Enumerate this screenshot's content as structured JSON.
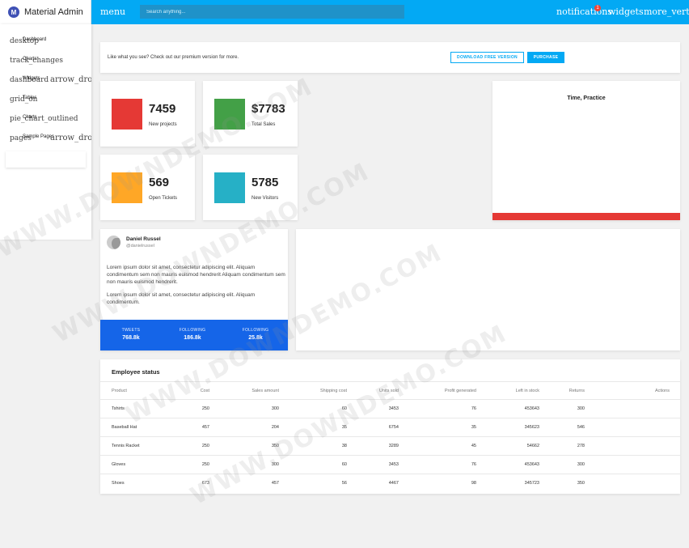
{
  "brand": {
    "logo_letter": "M",
    "name": "Material Admin"
  },
  "topbar": {
    "menu": "menu",
    "search_placeholder": "Search anything...",
    "notifications": "notifications",
    "notification_badge": "1",
    "widgets": "widgets",
    "more": "more_vert"
  },
  "sidebar": {
    "items": [
      {
        "icon": "desktop",
        "label": "Dashboard"
      },
      {
        "icon": "track_changes",
        "label": "Charts"
      },
      {
        "icon": "dashboard",
        "label": "Widgets",
        "arrow": "arrow_drop_down"
      },
      {
        "icon": "grid_on",
        "label": "Tables"
      },
      {
        "icon": "pie_chart_outlined",
        "label": "Charts"
      },
      {
        "icon": "pages",
        "label": "Sample Pages",
        "arrow": "arrow_drop_down"
      }
    ]
  },
  "promo": {
    "text": "Like what you see? Check out our premium version for more.",
    "download_label": "DOWNLOAD FREE VERSION",
    "purchase_label": "PURCHASE"
  },
  "stats": [
    {
      "value": "7459",
      "label": "New projects",
      "color": "#e53935"
    },
    {
      "value": "$7783",
      "label": "Total Sales",
      "color": "#43a047"
    },
    {
      "value": "569",
      "label": "Open Tickets",
      "color": "#ffa726"
    },
    {
      "value": "5785",
      "label": "New Visitors",
      "color": "#26b0c6"
    }
  ],
  "chart_card": {
    "title": "Time, Practice"
  },
  "profile": {
    "name": "Daniel Russel",
    "handle": "@danielrussel",
    "para1": "Lorem ipsum dolor sit amet, consectetur adipiscing elit. Aliquam condimentum sem non mauris euismod hendrerit Aliquam condimentum sem non mauris euismod hendrerit.",
    "para2": "Lorem ipsum dolor sit amet, consectetur adipiscing elit. Aliquam condimentum.",
    "stats": [
      {
        "label": "TWEETS",
        "value": "768.8k"
      },
      {
        "label": "FOLLOWING",
        "value": "186.8k"
      },
      {
        "label": "FOLLOWING",
        "value": "25.8k"
      }
    ]
  },
  "employee_status": {
    "title": "Employee status",
    "columns": [
      "Product",
      "Cost",
      "Sales amount",
      "Shipping cost",
      "Units sold",
      "Profit generated",
      "Left in stock",
      "Returns",
      "Actions"
    ],
    "rows": [
      [
        "Tshirts",
        "250",
        "300",
        "60",
        "3453",
        "76",
        "453643",
        "300",
        ""
      ],
      [
        "Baseball Hat",
        "457",
        "204",
        "35",
        "6754",
        "35",
        "345623",
        "546",
        ""
      ],
      [
        "Tennis Racket",
        "250",
        "350",
        "38",
        "3289",
        "45",
        "54662",
        "278",
        ""
      ],
      [
        "Gloves",
        "250",
        "300",
        "60",
        "3453",
        "76",
        "453643",
        "300",
        ""
      ],
      [
        "Shoes",
        "673",
        "457",
        "56",
        "4467",
        "98",
        "345723",
        "350",
        ""
      ]
    ]
  },
  "watermark": "WWW.DOWNDEMO.COM",
  "colors": {
    "primary": "#03a9f4",
    "profile_bar": "#1565e8",
    "chart_bar": "#e53935"
  }
}
